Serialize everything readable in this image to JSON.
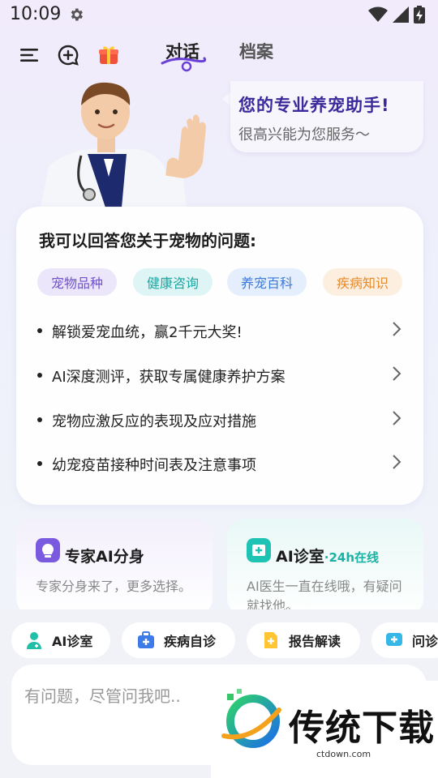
{
  "status_bar": {
    "time": "10:09",
    "icons": [
      "gear-icon",
      "wifi-icon",
      "signal-icon",
      "battery-icon"
    ]
  },
  "nav": {
    "tabs": [
      {
        "label": "对话",
        "active": true
      },
      {
        "label": "档案",
        "active": false
      }
    ],
    "icons": [
      "menu-icon",
      "new-chat-icon",
      "gift-icon"
    ]
  },
  "greeting": {
    "title": "您的专业养宠助手!",
    "subtitle": "很高兴能为您服务～"
  },
  "qa_card": {
    "title": "我可以回答您关于宠物的问题:",
    "chips": [
      {
        "label": "宠物品种",
        "bg": "#ece6fb",
        "color": "#6f52c8"
      },
      {
        "label": "健康咨询",
        "bg": "#dff5f5",
        "color": "#1ea5a0"
      },
      {
        "label": "养宠百科",
        "bg": "#e5eefc",
        "color": "#3c7ad9"
      },
      {
        "label": "疾病知识",
        "bg": "#fdefdf",
        "color": "#e48a2c"
      }
    ],
    "questions": [
      "解锁爱宠血统，赢2千元大奖!",
      "AI深度测评，获取专属健康养护方案",
      "宠物应激反应的表现及应对措施",
      "幼宠疫苗接种时间表及注意事项"
    ]
  },
  "features": [
    {
      "title": "专家AI分身",
      "accent": "",
      "desc": "专家分身来了，更多选择。",
      "icon": "brain-icon"
    },
    {
      "title": "AI诊室",
      "accent": "·24h在线",
      "desc": "AI医生一直在线哦，有疑问就找他。",
      "icon": "clinic-icon"
    }
  ],
  "quick_actions": [
    {
      "label": "AI诊室",
      "icon": "doctor-icon"
    },
    {
      "label": "疾病自诊",
      "icon": "medical-kit-icon"
    },
    {
      "label": "报告解读",
      "icon": "report-icon"
    },
    {
      "label": "问诊",
      "icon": "chat-plus-icon"
    }
  ],
  "input": {
    "placeholder": "有问题，尽管问我吧.."
  },
  "watermark": {
    "text": "传统下载",
    "sub": "ctdown.com"
  },
  "colors": {
    "accent": "#3b2a9c",
    "teal": "#19b3a6",
    "background": "#f1ebfb"
  }
}
